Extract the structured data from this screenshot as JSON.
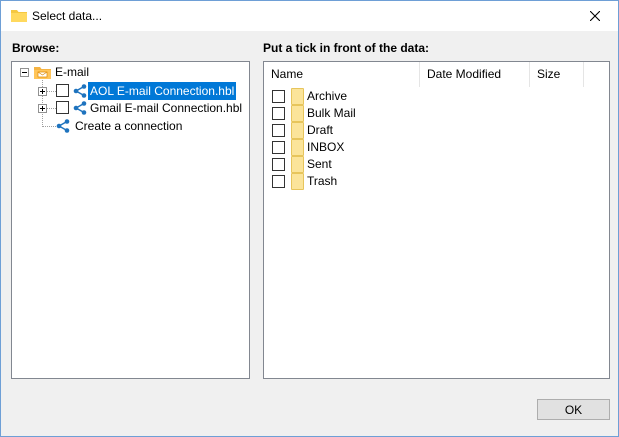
{
  "window": {
    "title": "Select data...",
    "close_icon": "close-icon",
    "title_icon": "folder-icon"
  },
  "browse": {
    "label": "Browse:",
    "root": {
      "label": "E-mail",
      "icon": "email-folder-icon",
      "expanded": true
    },
    "items": [
      {
        "label": "AOL E-mail Connection.hbl",
        "icon": "share-icon",
        "selected": true,
        "checked": false
      },
      {
        "label": "Gmail E-mail Connection.hbl",
        "icon": "share-icon",
        "selected": false,
        "checked": false
      },
      {
        "label": "Create a connection",
        "icon": "share-icon"
      }
    ]
  },
  "data": {
    "label": "Put a tick in front of the data:",
    "columns": [
      "Name",
      "Date Modified",
      "Size"
    ],
    "rows": [
      {
        "name": "Archive",
        "checked": false
      },
      {
        "name": "Bulk Mail",
        "checked": false
      },
      {
        "name": "Draft",
        "checked": false
      },
      {
        "name": "INBOX",
        "checked": false
      },
      {
        "name": "Sent",
        "checked": false
      },
      {
        "name": "Trash",
        "checked": false
      }
    ]
  },
  "footer": {
    "ok_label": "OK"
  },
  "colors": {
    "selection": "#0078d7",
    "share_icon": "#1e73be",
    "folder": "#fbe49a"
  }
}
